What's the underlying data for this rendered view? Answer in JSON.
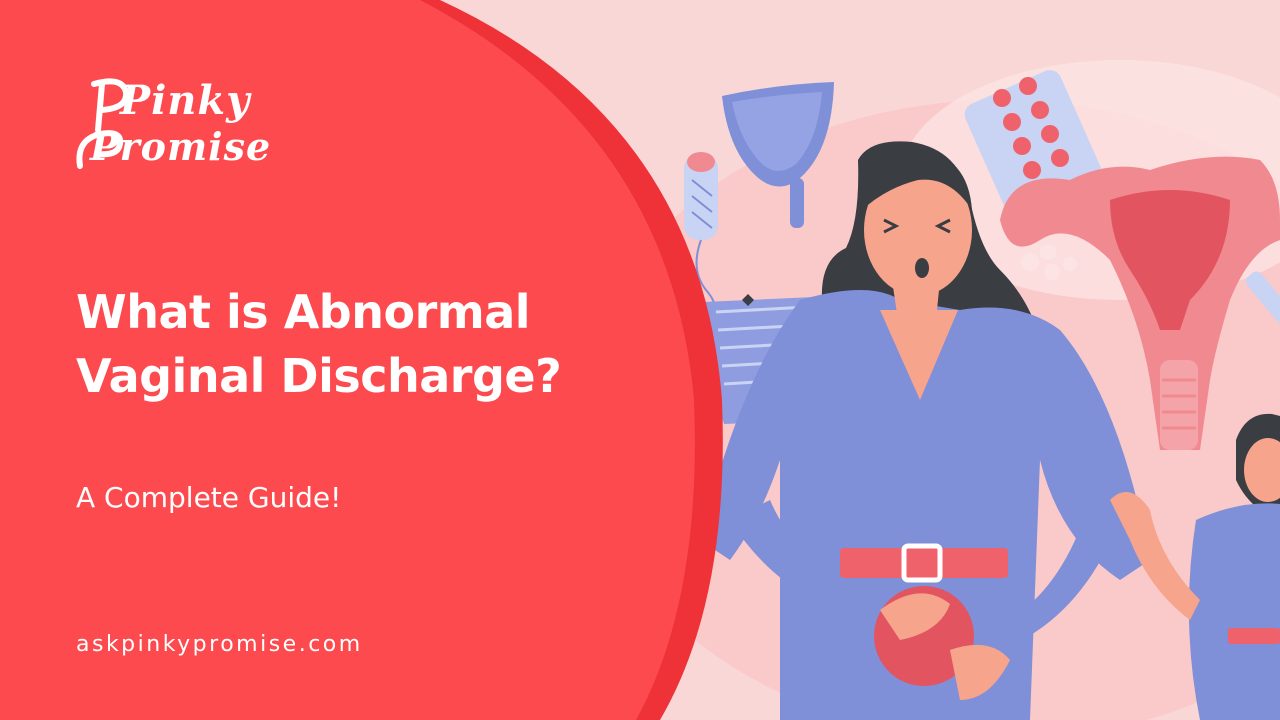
{
  "brand": {
    "logo_line1": "Pinky",
    "logo_line2": "Promise"
  },
  "title": {
    "line1": "What is Abnormal",
    "line2": "Vaginal Discharge?"
  },
  "subtitle": "A Complete Guide!",
  "website": "askpinkypromise.com",
  "colors": {
    "panel": "#fd4a4e",
    "panel_rim": "#ee3237",
    "background": "#f9d7d7",
    "dress": "#7f8fd8",
    "skin": "#f7a48d",
    "belt": "#f0626b",
    "hair": "#3a3d42"
  },
  "illustration": {
    "items": [
      "menstrual-cup-icon",
      "tampon-icon",
      "pill-blister-icon",
      "uterus-icon",
      "underwear-icon",
      "woman-in-pain-figure",
      "second-woman-figure"
    ]
  }
}
